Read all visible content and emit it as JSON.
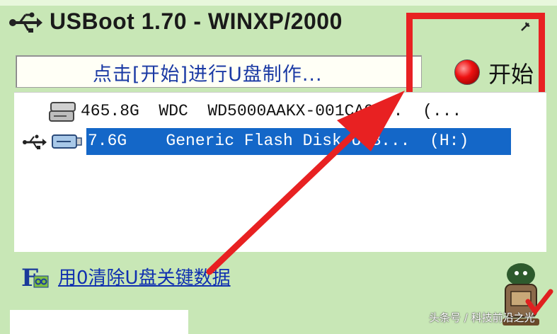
{
  "window": {
    "title": "USBoot 1.70 - WINXP/2000"
  },
  "status": {
    "text": "点击[开始]进行U盘制作..."
  },
  "start_button": {
    "label": "开始"
  },
  "drives": [
    {
      "text": "465.8G  WDC  WD5000AAKX-001CA0...  (..."
    },
    {
      "text": "7.6G    Generic Flash Disk USB...  (H:)"
    }
  ],
  "footer": {
    "erase_link": "用0清除U盘关键数据"
  },
  "watermark": "头条号 / 科技前沿之光",
  "colors": {
    "window_bg": "#c8e7b6",
    "selection": "#1467c8",
    "highlight": "#e82122",
    "status_text": "#1b3aa4"
  }
}
